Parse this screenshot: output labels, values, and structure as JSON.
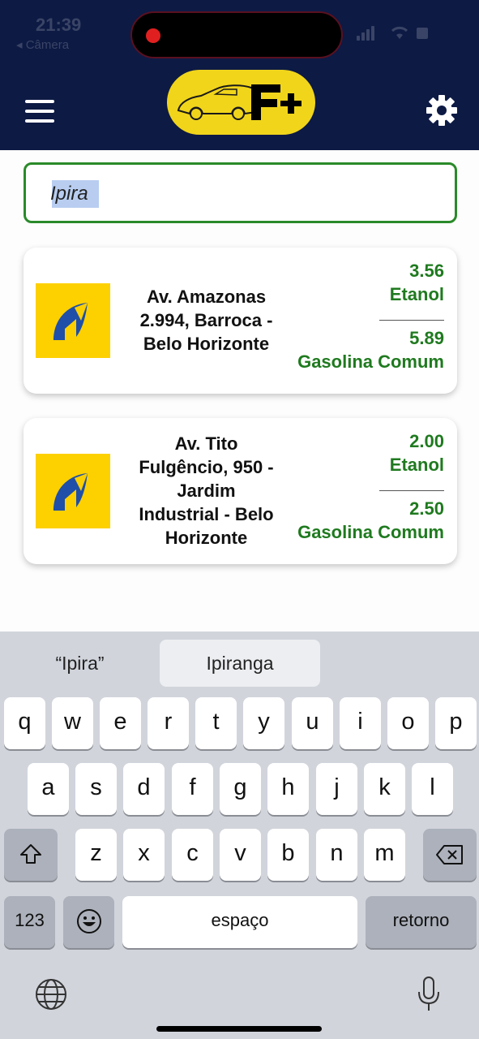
{
  "status_bar": {
    "time": "21:39",
    "back_label": "◂ Câmera"
  },
  "header": {
    "logo_text": "F+"
  },
  "search": {
    "value": "Ipira"
  },
  "stations": [
    {
      "address_lines": [
        "Av. Amazonas",
        "2.994, Barroca -",
        "Belo Horizonte"
      ],
      "fuel1_price": "3.56",
      "fuel1_name": "Etanol",
      "fuel2_price": "5.89",
      "fuel2_name": "Gasolina Comum"
    },
    {
      "address_lines": [
        "Av. Tito",
        "Fulgêncio, 950 -",
        "Jardim",
        "Industrial - Belo",
        "Horizonte"
      ],
      "fuel1_price": "2.00",
      "fuel1_name": "Etanol",
      "fuel2_price": "2.50",
      "fuel2_name": "Gasolina Comum"
    }
  ],
  "keyboard": {
    "suggestion_literal": "“Ipira”",
    "suggestion_word": "Ipiranga",
    "row1": [
      "q",
      "w",
      "e",
      "r",
      "t",
      "y",
      "u",
      "i",
      "o",
      "p"
    ],
    "row2": [
      "a",
      "s",
      "d",
      "f",
      "g",
      "h",
      "j",
      "k",
      "l"
    ],
    "row3": [
      "z",
      "x",
      "c",
      "v",
      "b",
      "n",
      "m"
    ],
    "numbers_label": "123",
    "space_label": "espaço",
    "return_label": "retorno"
  },
  "colors": {
    "header_bg": "#0d1a44",
    "accent_green": "#1f7a1f",
    "brand_yellow": "#fdd000",
    "logo_yellow": "#f1d51b"
  },
  "icons": [
    "menu-icon",
    "settings-gear-icon",
    "car-logo-icon",
    "ipiranga-brand-icon",
    "shift-icon",
    "backspace-icon",
    "emoji-icon",
    "globe-icon",
    "microphone-icon"
  ]
}
